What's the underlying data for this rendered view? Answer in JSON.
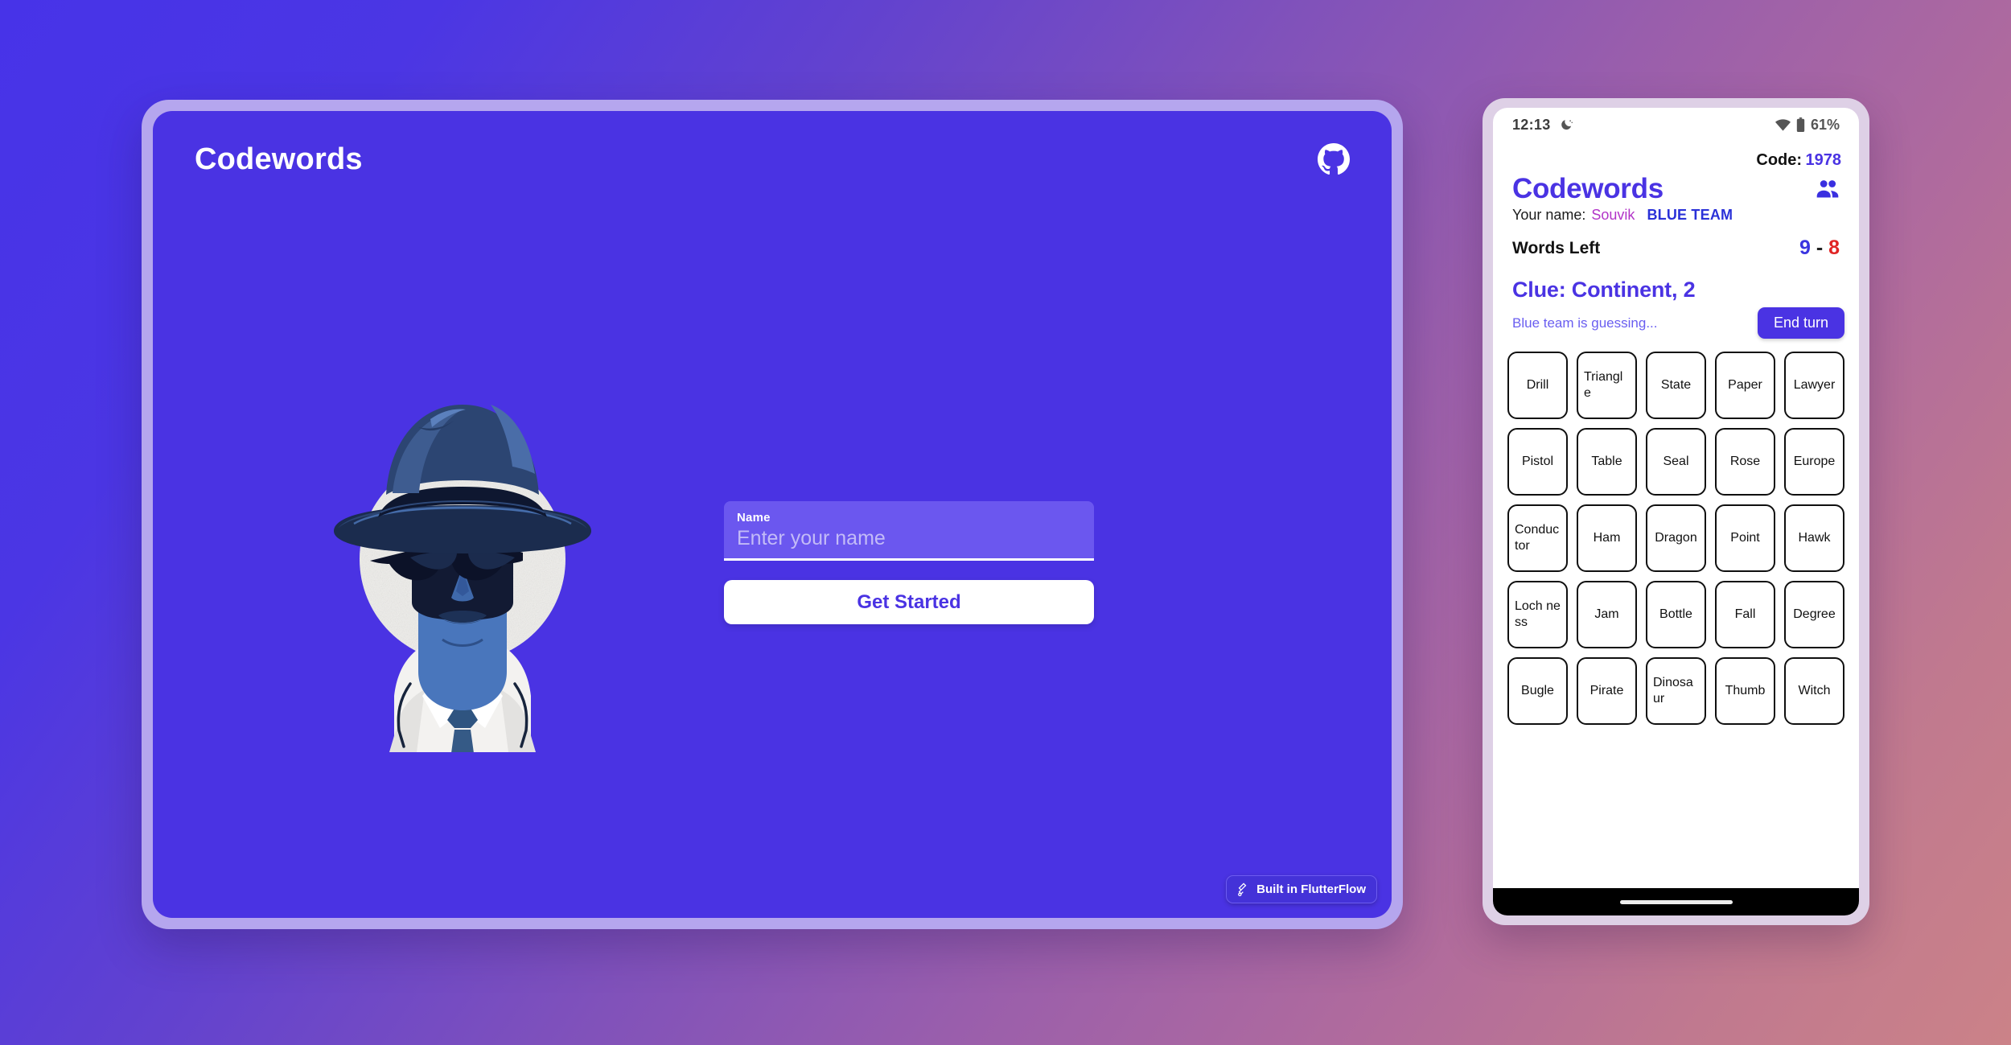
{
  "desktop": {
    "title": "Codewords",
    "github_icon": "github-icon",
    "form": {
      "field_label": "Name",
      "field_value": "",
      "field_placeholder": "Enter your name",
      "submit_label": "Get Started"
    },
    "illustration": "detective-spy-illustration",
    "badge": {
      "label": "Built in FlutterFlow",
      "icon": "flutterflow-icon"
    }
  },
  "phone": {
    "statusbar": {
      "time": "12:13",
      "dnd_icon": "do-not-disturb-moon-icon",
      "wifi_icon": "wifi-icon",
      "battery_icon": "battery-icon",
      "battery_text": "61%"
    },
    "code": {
      "label": "Code:",
      "value": "1978"
    },
    "title": "Codewords",
    "people_icon": "people-group-icon",
    "player": {
      "name_label": "Your name:",
      "name": "Souvik",
      "team": "BLUE TEAM"
    },
    "words_left": {
      "label": "Words Left",
      "blue": "9",
      "dash": "-",
      "red": "8"
    },
    "clue": {
      "text": "Clue: Continent, 2",
      "status": "Blue team is guessing...",
      "end_turn_label": "End turn"
    },
    "grid": [
      "Drill",
      "Triangle",
      "State",
      "Paper",
      "Lawyer",
      "Pistol",
      "Table",
      "Seal",
      "Rose",
      "Europe",
      "Conductor",
      "Ham",
      "Dragon",
      "Point",
      "Hawk",
      "Loch ness",
      "Jam",
      "Bottle",
      "Fall",
      "Degree",
      "Bugle",
      "Pirate",
      "Dinosaur",
      "Thumb",
      "Witch"
    ],
    "home_indicator": "home-indicator"
  },
  "colors": {
    "brand_indigo": "#4a33e3",
    "blue_team": "#3a34e0",
    "red_team": "#e02424",
    "player_name": "#b234c8"
  }
}
